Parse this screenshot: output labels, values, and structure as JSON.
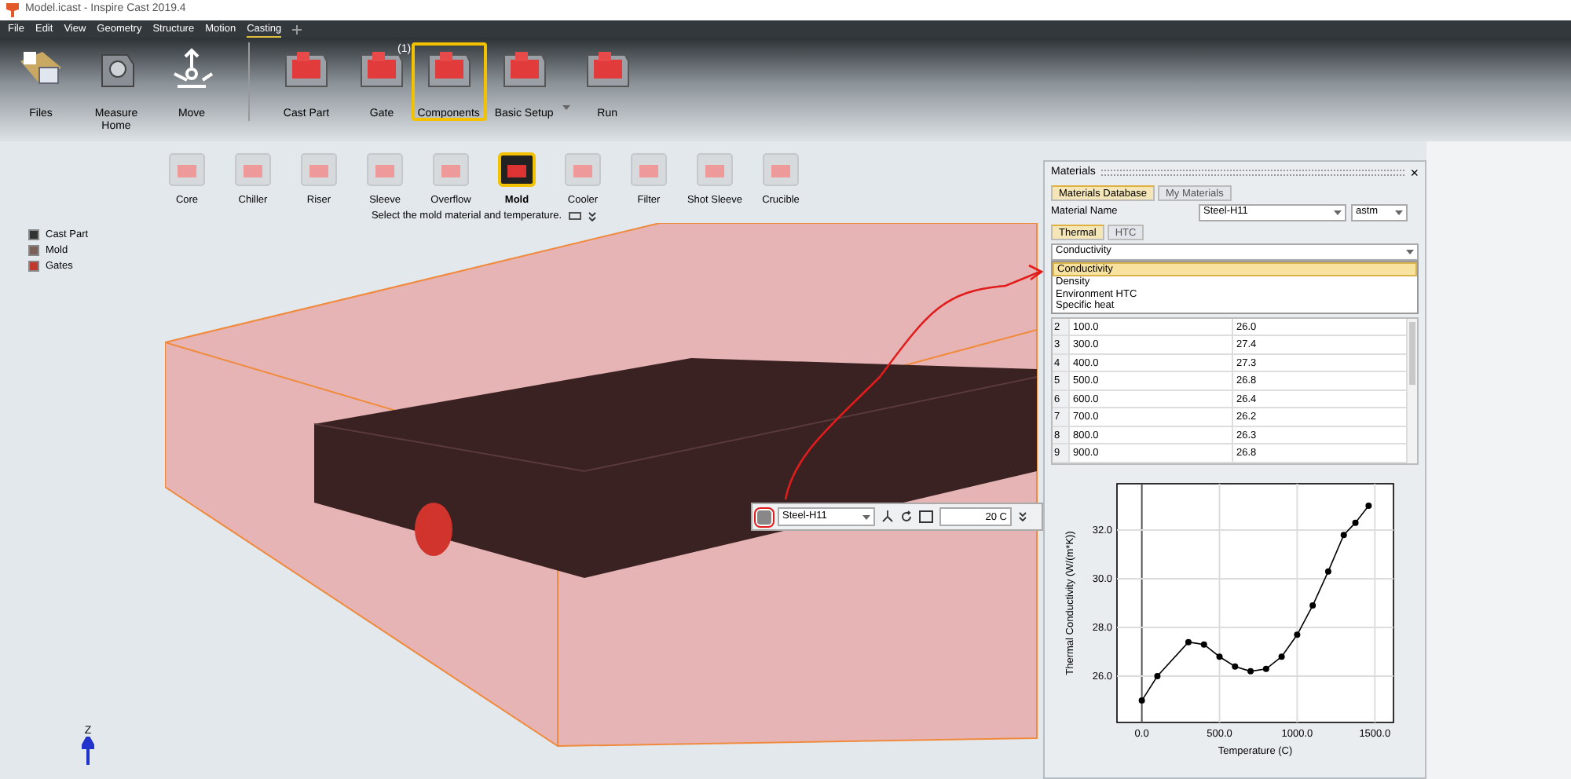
{
  "window": {
    "title": "Model.icast - Inspire Cast 2019.4"
  },
  "menu": [
    {
      "label": "File",
      "selected": false
    },
    {
      "label": "Edit",
      "selected": false
    },
    {
      "label": "View",
      "selected": false
    },
    {
      "label": "Geometry",
      "selected": false
    },
    {
      "label": "Structure",
      "selected": false
    },
    {
      "label": "Motion",
      "selected": false
    },
    {
      "label": "Casting",
      "selected": true
    }
  ],
  "ribbon": [
    {
      "label": "Files",
      "selected": false,
      "kind": "folder"
    },
    {
      "label": "Measure\nHome",
      "selected": false,
      "kind": "measure"
    },
    {
      "label": "Move",
      "selected": false,
      "kind": "move"
    },
    {
      "label": "Cast Part",
      "selected": false,
      "kind": "part"
    },
    {
      "label": "Gate",
      "selected": false,
      "kind": "part",
      "badge": "(1)"
    },
    {
      "label": "Components",
      "selected": true,
      "kind": "part"
    },
    {
      "label": "Basic Setup",
      "selected": false,
      "kind": "part",
      "dropdown": true
    },
    {
      "label": "Run",
      "selected": false,
      "kind": "part"
    }
  ],
  "components": {
    "items": [
      {
        "label": "Core",
        "selected": false
      },
      {
        "label": "Chiller",
        "selected": false
      },
      {
        "label": "Riser",
        "selected": false
      },
      {
        "label": "Sleeve",
        "selected": false
      },
      {
        "label": "Overflow",
        "selected": false
      },
      {
        "label": "Mold",
        "selected": true
      },
      {
        "label": "Cooler",
        "selected": false
      },
      {
        "label": "Filter",
        "selected": false
      },
      {
        "label": "Shot Sleeve",
        "selected": false
      },
      {
        "label": "Crucible",
        "selected": false
      }
    ],
    "hint": "Select the mold material and temperature."
  },
  "legend": [
    {
      "label": "Cast Part",
      "color": "#333333"
    },
    {
      "label": "Mold",
      "color": "#7a6058"
    },
    {
      "label": "Gates",
      "color": "#c0392b"
    }
  ],
  "mini_toolbar": {
    "material": "Steel-H11",
    "temperature": "20 C"
  },
  "axis_label": "Z",
  "materials_panel": {
    "title": "Materials",
    "close": "×",
    "tabs": [
      {
        "label": "Materials Database",
        "selected": true
      },
      {
        "label": "My Materials",
        "selected": false
      }
    ],
    "material_name_label": "Material Name",
    "material": "Steel-H11",
    "standard": "astm",
    "property_tabs": [
      {
        "label": "Thermal",
        "selected": true
      },
      {
        "label": "HTC",
        "selected": false
      }
    ],
    "property": "Conductivity",
    "property_options": [
      {
        "label": "Conductivity",
        "selected": true
      },
      {
        "label": "Density",
        "selected": false
      },
      {
        "label": "Environment HTC",
        "selected": false
      },
      {
        "label": "Specific heat",
        "selected": false
      }
    ],
    "table": {
      "rows": [
        [
          "2",
          "100.0",
          "26.0"
        ],
        [
          "3",
          "300.0",
          "27.4"
        ],
        [
          "4",
          "400.0",
          "27.3"
        ],
        [
          "5",
          "500.0",
          "26.8"
        ],
        [
          "6",
          "600.0",
          "26.4"
        ],
        [
          "7",
          "700.0",
          "26.2"
        ],
        [
          "8",
          "800.0",
          "26.3"
        ],
        [
          "9",
          "900.0",
          "26.8"
        ]
      ]
    },
    "chart_data": {
      "type": "line",
      "xlabel": "Temperature (C)",
      "ylabel": "Thermal Conductivity (W/(m*K))",
      "grid": true,
      "x": [
        0,
        100,
        300,
        400,
        500,
        600,
        700,
        800,
        900,
        1000,
        1100,
        1200,
        1300,
        1375,
        1460
      ],
      "series": [
        {
          "color": "#000000",
          "marker": "o",
          "values": [
            25.0,
            26.0,
            27.4,
            27.3,
            26.8,
            26.4,
            26.2,
            26.3,
            26.8,
            27.7,
            28.9,
            30.3,
            31.8,
            32.3,
            33.0
          ]
        }
      ],
      "xlim": [
        -160,
        1620
      ],
      "ylim": [
        24.1,
        33.9
      ],
      "xticks": [
        {
          "value": 0,
          "label": "0.0"
        },
        {
          "value": 500,
          "label": "500.0"
        },
        {
          "value": 1000,
          "label": "1000.0"
        },
        {
          "value": 1500,
          "label": "1500.0"
        }
      ],
      "yticks": [
        {
          "value": 26,
          "label": "26.0"
        },
        {
          "value": 28,
          "label": "28.0"
        },
        {
          "value": 30,
          "label": "30.0"
        },
        {
          "value": 32,
          "label": "32.0"
        }
      ]
    }
  }
}
